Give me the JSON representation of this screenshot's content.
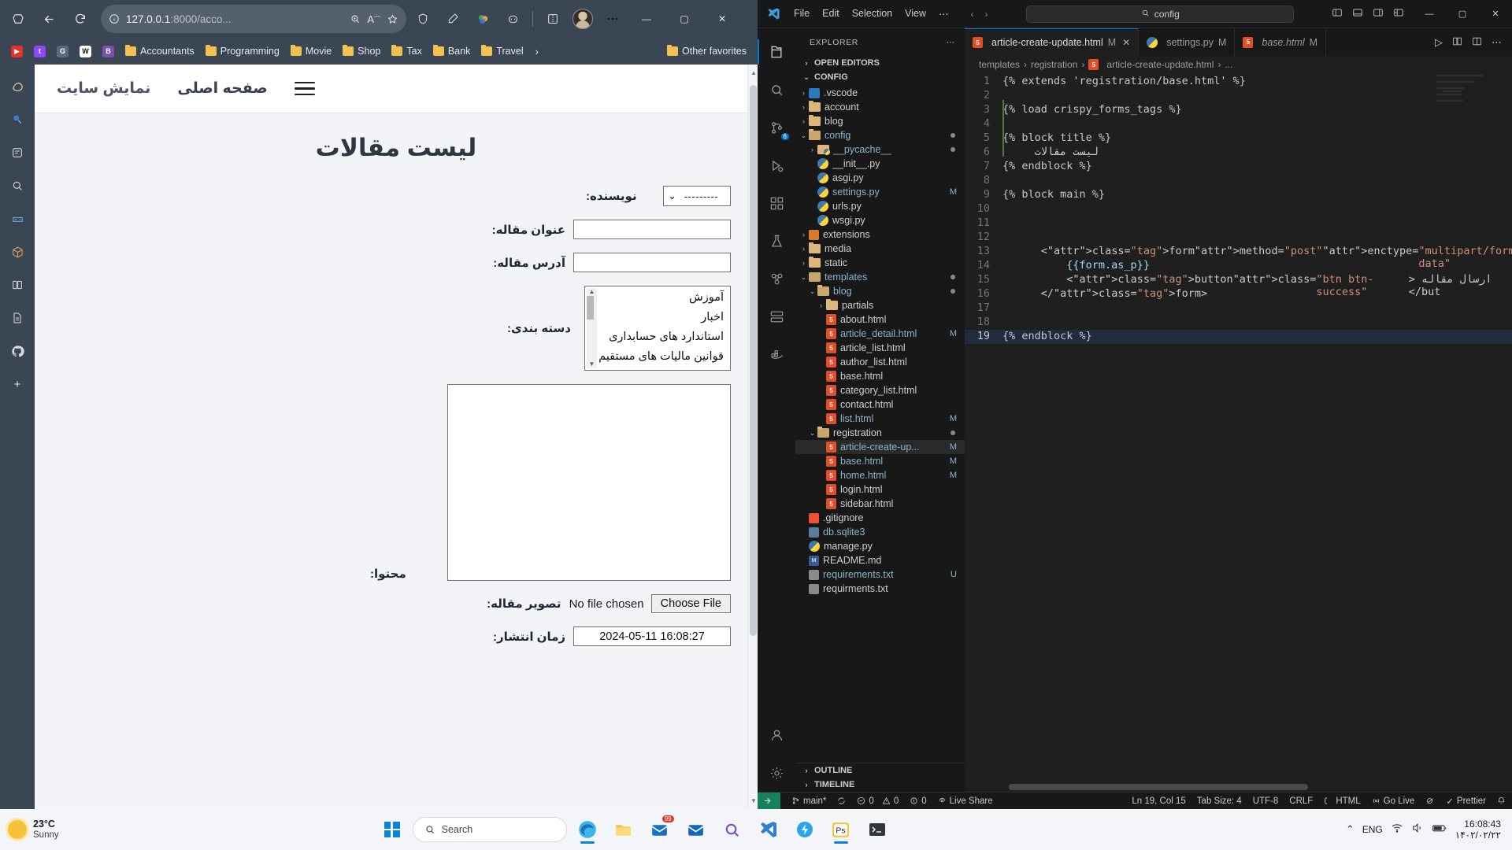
{
  "browser": {
    "nav": {
      "back_icon": "arrow-left-icon",
      "refresh_icon": "refresh-icon",
      "tabs_icon": "tab-list-icon",
      "url_text": "127.0.0.1",
      "url_suffix": ":8000/acco...",
      "info_icon": "info-icon",
      "zoom_icon": "zoom-icon",
      "read_aloud_icon": "read-aloud-icon",
      "favorite_icon": "star-icon",
      "shield_icon": "shield-icon",
      "pen_icon": "pen-icon",
      "collections_icon": "collections-icon",
      "copilot_icon": "copilot-icon",
      "split_icon": "split-screen-icon",
      "more_icon": "more-icon",
      "minimize": "—",
      "maximize": "▢",
      "close": "✕"
    },
    "bookmarks": [
      {
        "label": "",
        "icon": "youtube-icon",
        "color": "#e8302a",
        "glyph": "▶"
      },
      {
        "label": "",
        "icon": "twitch-icon",
        "color": "#9146ff",
        "glyph": "t"
      },
      {
        "label": "",
        "icon": "google-icon",
        "color": "#4285f4",
        "glyph": "G"
      },
      {
        "label": "",
        "icon": "wikipedia-icon",
        "color": "#ffffff",
        "glyph": "W"
      },
      {
        "label": "",
        "icon": "bootstrap-icon",
        "color": "#7952b3",
        "glyph": "B"
      },
      {
        "label": "Accountants",
        "icon": "folder-icon"
      },
      {
        "label": "Programming",
        "icon": "folder-icon"
      },
      {
        "label": "Movie",
        "icon": "folder-icon"
      },
      {
        "label": "Shop",
        "icon": "folder-icon"
      },
      {
        "label": "Tax",
        "icon": "folder-icon"
      },
      {
        "label": "Bank",
        "icon": "folder-icon"
      },
      {
        "label": "Travel",
        "icon": "folder-icon"
      }
    ],
    "bookmarks_overflow": "›",
    "other_favorites": "Other favorites",
    "rail_icons": [
      "copilot-icon",
      "search-icon",
      "browser-essentials-icon",
      "drop-icon",
      "games-icon",
      "tools-icon",
      "split-icon",
      "github-icon",
      "add-icon"
    ]
  },
  "site": {
    "nav": {
      "view_site": "نمایش سایت",
      "home": "صفحه اصلی",
      "menu_icon": "hamburger-icon"
    },
    "page_title": "لیست مقالات",
    "form": {
      "author": {
        "label": "نویسنده:",
        "value": "---------",
        "chevron": "chevron-down-icon"
      },
      "title_field": {
        "label": "عنوان مقاله:",
        "value": ""
      },
      "slug_field": {
        "label": "آدرس مقاله:",
        "value": ""
      },
      "category": {
        "label": "دسته بندی:",
        "options": [
          "آموزش",
          "اخبار",
          "استاندارد های حسابداری",
          "قوانین مالیات های مستقیم"
        ]
      },
      "content": {
        "label": "محتوا:",
        "value": ""
      },
      "image": {
        "label": "تصویر مقاله:",
        "button": "Choose File",
        "status": "No file chosen"
      },
      "publish": {
        "label": "زمان انتشار:",
        "value": "2024-05-11 16:08:27"
      }
    }
  },
  "vscode": {
    "menu": [
      "File",
      "Edit",
      "Selection",
      "View",
      "⋯"
    ],
    "nav_back": "‹",
    "nav_forward": "›",
    "search_placeholder": "config",
    "search_icon": "search-icon",
    "layout_icons": [
      "toggle-primary-sidebar-icon",
      "toggle-panel-icon",
      "toggle-secondary-sidebar-icon",
      "customize-layout-icon"
    ],
    "window_buttons": [
      "—",
      "▢",
      "✕"
    ],
    "explorer_title": "EXPLORER",
    "explorer_more": "⋯",
    "open_editors": "OPEN EDITORS",
    "root_folder": "CONFIG",
    "tree": [
      {
        "name": ".vscode",
        "type": "vscode",
        "depth": 1,
        "arrow": "›"
      },
      {
        "name": "account",
        "type": "folder",
        "depth": 1,
        "arrow": "›"
      },
      {
        "name": "blog",
        "type": "folder",
        "depth": 1,
        "arrow": "›"
      },
      {
        "name": "config",
        "type": "folder-open",
        "depth": 1,
        "arrow": "⌄",
        "dot": true,
        "modified": true
      },
      {
        "name": "__pycache__",
        "type": "pycache",
        "depth": 2,
        "arrow": "›",
        "dot": true,
        "modified": true
      },
      {
        "name": "__init__.py",
        "type": "py",
        "depth": 2
      },
      {
        "name": "asgi.py",
        "type": "py",
        "depth": 2
      },
      {
        "name": "settings.py",
        "type": "py",
        "depth": 2,
        "badge": "M",
        "modified": true
      },
      {
        "name": "urls.py",
        "type": "py",
        "depth": 2
      },
      {
        "name": "wsgi.py",
        "type": "py",
        "depth": 2
      },
      {
        "name": "extensions",
        "type": "ext",
        "depth": 1,
        "arrow": "›"
      },
      {
        "name": "media",
        "type": "folder",
        "depth": 1,
        "arrow": "›"
      },
      {
        "name": "static",
        "type": "folder",
        "depth": 1,
        "arrow": "›"
      },
      {
        "name": "templates",
        "type": "tpl",
        "depth": 1,
        "arrow": "⌄",
        "dot": true,
        "modified": true
      },
      {
        "name": "blog",
        "type": "folder-open",
        "depth": 2,
        "arrow": "⌄",
        "dot": true,
        "modified": true
      },
      {
        "name": "partials",
        "type": "folder",
        "depth": 3,
        "arrow": "›"
      },
      {
        "name": "about.html",
        "type": "html",
        "depth": 3
      },
      {
        "name": "article_detail.html",
        "type": "html",
        "depth": 3,
        "badge": "M",
        "modified": true
      },
      {
        "name": "article_list.html",
        "type": "html",
        "depth": 3
      },
      {
        "name": "author_list.html",
        "type": "html",
        "depth": 3
      },
      {
        "name": "base.html",
        "type": "html",
        "depth": 3
      },
      {
        "name": "category_list.html",
        "type": "html",
        "depth": 3
      },
      {
        "name": "contact.html",
        "type": "html",
        "depth": 3
      },
      {
        "name": "list.html",
        "type": "html",
        "depth": 3,
        "badge": "M",
        "modified": true
      },
      {
        "name": "registration",
        "type": "folder-open",
        "depth": 2,
        "arrow": "⌄",
        "dot": true
      },
      {
        "name": "article-create-up...",
        "type": "html",
        "depth": 3,
        "badge": "M",
        "modified": true,
        "selected": true
      },
      {
        "name": "base.html",
        "type": "html",
        "depth": 3,
        "badge": "M",
        "modified": true
      },
      {
        "name": "home.html",
        "type": "html",
        "depth": 3,
        "badge": "M",
        "modified": true
      },
      {
        "name": "login.html",
        "type": "html",
        "depth": 3
      },
      {
        "name": "sidebar.html",
        "type": "html",
        "depth": 3
      },
      {
        "name": ".gitignore",
        "type": "git",
        "depth": 1
      },
      {
        "name": "db.sqlite3",
        "type": "db",
        "depth": 1,
        "modified": true
      },
      {
        "name": "manage.py",
        "type": "py",
        "depth": 1
      },
      {
        "name": "README.md",
        "type": "md",
        "depth": 1
      },
      {
        "name": "requirements.txt",
        "type": "txt",
        "depth": 1,
        "badge": "U",
        "modified": true
      },
      {
        "name": "requirments.txt",
        "type": "txt",
        "depth": 1
      }
    ],
    "outline": "OUTLINE",
    "timeline": "TIMELINE",
    "tabs": [
      {
        "label": "article-create-update.html",
        "badge": "M",
        "icon": "html5-icon",
        "active": true,
        "close": "✕"
      },
      {
        "label": "settings.py",
        "badge": "M",
        "icon": "python-icon",
        "active": false
      },
      {
        "label": "base.html",
        "badge": "M",
        "icon": "html5-icon",
        "active": false
      }
    ],
    "tab_actions": [
      "run-icon",
      "split-editor-icon",
      "open-changes-icon",
      "more-actions-icon"
    ],
    "breadcrumb": [
      "templates",
      "registration",
      "article-create-update.html",
      "..."
    ],
    "code": [
      {
        "n": 1,
        "text": "{% extends 'registration/base.html' %}"
      },
      {
        "n": 2,
        "text": ""
      },
      {
        "n": 3,
        "text": "{% load crispy_forms_tags %}"
      },
      {
        "n": 4,
        "text": ""
      },
      {
        "n": 5,
        "text": "{% block title %}"
      },
      {
        "n": 6,
        "text": "     لیست مقالات"
      },
      {
        "n": 7,
        "text": "{% endblock %}"
      },
      {
        "n": 8,
        "text": ""
      },
      {
        "n": 9,
        "text": "{% block main %}"
      },
      {
        "n": 10,
        "text": ""
      },
      {
        "n": 11,
        "text": ""
      },
      {
        "n": 12,
        "text": ""
      },
      {
        "n": 13,
        "text": "      <form method=\"post\" enctype=\"multipart/form-data\">{% c"
      },
      {
        "n": 14,
        "text": "          {{form.as_p}}"
      },
      {
        "n": 15,
        "text": "          <button class=\"btn btn-success\"> ارسال مقاله </but"
      },
      {
        "n": 16,
        "text": "      </form>"
      },
      {
        "n": 17,
        "text": ""
      },
      {
        "n": 18,
        "text": ""
      },
      {
        "n": 19,
        "text": "{% endblock %}",
        "current": true
      }
    ],
    "status": {
      "remote": "main*",
      "sync_icon": "sync-icon",
      "errors": "0",
      "warnings": "0",
      "ports": "0",
      "go_live_left": "Live Share",
      "cursor": "Ln 19, Col 15",
      "tab_size": "Tab Size: 4",
      "encoding": "UTF-8",
      "eol": "CRLF",
      "language": "HTML",
      "go_live": "Go Live",
      "prettier": "Prettier",
      "bell_icon": "bell-icon"
    }
  },
  "taskbar": {
    "weather_temp": "23°C",
    "weather_cond": "Sunny",
    "search_placeholder": "Search",
    "search_icon": "search-icon",
    "start_icon": "windows-start-icon",
    "apps": [
      {
        "name": "edge-icon",
        "active": true
      },
      {
        "name": "file-explorer-icon",
        "active": false
      },
      {
        "name": "outlook-icon",
        "active": false,
        "badge": "99"
      },
      {
        "name": "mail-icon",
        "active": false
      },
      {
        "name": "search-app-icon",
        "active": false
      },
      {
        "name": "vscode-icon",
        "active": false
      },
      {
        "name": "power-icon",
        "active": false
      },
      {
        "name": "photoshop-icon",
        "active": true
      },
      {
        "name": "terminal-icon",
        "active": false
      }
    ],
    "tray_chevron": "⌃",
    "language": "ENG",
    "time": "16:08:43",
    "date": "۱۴۰۲/۰۲/۲۲"
  }
}
